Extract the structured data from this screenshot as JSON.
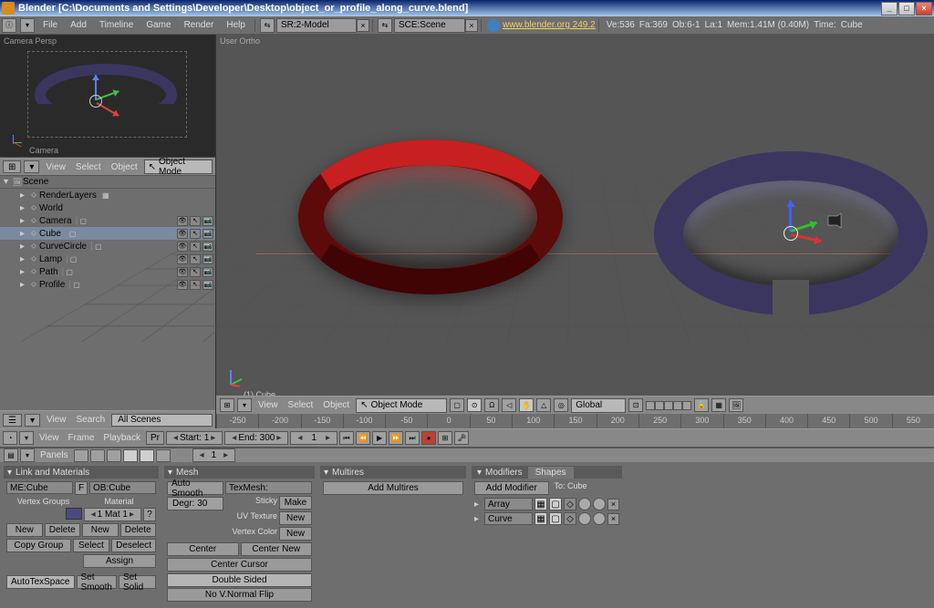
{
  "window": {
    "title": "Blender [C:\\Documents and Settings\\Developer\\Desktop\\object_or_profile_along_curve.blend]",
    "buttons": {
      "min": "_",
      "max": "□",
      "close": "×"
    }
  },
  "menu": {
    "items": [
      "File",
      "Add",
      "Timeline",
      "Game",
      "Render",
      "Help"
    ],
    "screen_label": "SR:2-Model",
    "scene_label": "SCE:Scene",
    "url": "www.blender.org 249.2",
    "stats": {
      "ve": "Ve:536",
      "fa": "Fa:369",
      "ob": "Ob:6-1",
      "la": "La:1",
      "mem": "Mem:1.41M (0.40M)",
      "time": "Time:",
      "obj": "Cube"
    }
  },
  "camera_preview": {
    "label": "Camera Persp",
    "obj_label": "Camera"
  },
  "left_header": {
    "view": "View",
    "select": "Select",
    "object": "Object",
    "mode": "Object Mode"
  },
  "outliner": {
    "root": "Scene",
    "items": [
      {
        "name": "RenderLayers",
        "indent": 1,
        "type": "layer"
      },
      {
        "name": "World",
        "indent": 1,
        "type": "world"
      },
      {
        "name": "Camera",
        "indent": 1,
        "type": "object"
      },
      {
        "name": "Cube",
        "indent": 1,
        "type": "object",
        "selected": true
      },
      {
        "name": "CurveCircle",
        "indent": 1,
        "type": "object"
      },
      {
        "name": "Lamp",
        "indent": 1,
        "type": "object"
      },
      {
        "name": "Path",
        "indent": 1,
        "type": "object"
      },
      {
        "name": "Profile",
        "indent": 1,
        "type": "object"
      }
    ]
  },
  "outliner_footer": {
    "view": "View",
    "search": "Search",
    "scenes": "All Scenes"
  },
  "view3d": {
    "label": "User Ortho",
    "object_label": "(1) Cube",
    "header": {
      "view": "View",
      "select": "Select",
      "object": "Object",
      "mode": "Object Mode",
      "global": "Global"
    },
    "ruler": [
      "-250",
      "-200",
      "-150",
      "-100",
      "-50",
      "0",
      "50",
      "100",
      "150",
      "200",
      "250",
      "300",
      "350",
      "400",
      "450",
      "500",
      "550"
    ]
  },
  "timeline": {
    "view": "View",
    "frame": "Frame",
    "playback": "Playback",
    "prefix": "Pr",
    "start": "Start: 1",
    "end": "End: 300",
    "current": "1"
  },
  "panels_header": {
    "label": "Panels",
    "page": "1"
  },
  "link_materials": {
    "title": "Link and Materials",
    "me": "ME:Cube",
    "f": "F",
    "ob": "OB:Cube",
    "vertex_groups": "Vertex Groups",
    "material": "Material",
    "mat_spin": "1 Mat 1",
    "question": "?",
    "new": "New",
    "delete": "Delete",
    "select": "Select",
    "deselect": "Deselect",
    "assign": "Assign",
    "copy_group": "Copy Group",
    "autotex": "AutoTexSpace",
    "setsmooth": "Set Smooth",
    "setsolid": "Set Solid"
  },
  "mesh_panel": {
    "title": "Mesh",
    "auto_smooth": "Auto Smooth",
    "degr": "Degr: 30",
    "texmesh": "TexMesh:",
    "sticky": "Sticky",
    "make": "Make",
    "uv": "UV Texture",
    "new": "New",
    "vc": "Vertex Color",
    "center": "Center",
    "center_new": "Center New",
    "center_cursor": "Center Cursor",
    "double": "Double Sided",
    "nov": "No V.Normal Flip"
  },
  "multires": {
    "title": "Multires",
    "add": "Add Multires"
  },
  "modifiers": {
    "title": "Modifiers",
    "shapes": "Shapes",
    "add": "Add Modifier",
    "to": "To: Cube",
    "mods": [
      {
        "name": "Array"
      },
      {
        "name": "Curve"
      }
    ]
  }
}
